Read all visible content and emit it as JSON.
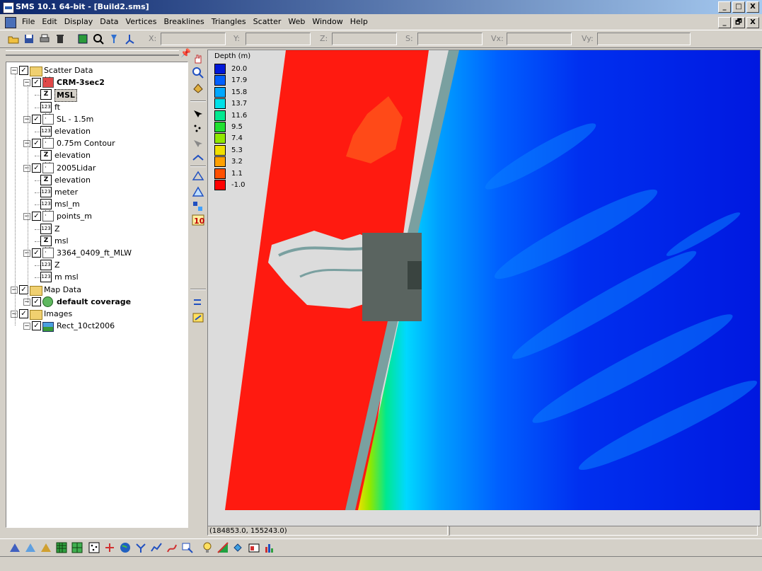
{
  "window": {
    "title": "SMS 10.1 64-bit - [Build2.sms]",
    "buttons": [
      "_",
      "□",
      "X"
    ],
    "mdi_buttons": [
      "_",
      "🗗",
      "X"
    ]
  },
  "menu": [
    "File",
    "Edit",
    "Display",
    "Data",
    "Vertices",
    "Breaklines",
    "Triangles",
    "Scatter",
    "Web",
    "Window",
    "Help"
  ],
  "toolbar": {
    "coord_labels": [
      "X:",
      "Y:",
      "Z:",
      "S:",
      "Vx:",
      "Vy:"
    ],
    "icons": [
      "open-icon",
      "save-icon",
      "print-icon",
      "delete-icon",
      "refresh-icon",
      "zoom-icon",
      "probe-icon",
      "axis-icon"
    ]
  },
  "tree": [
    {
      "label": "Scatter Data",
      "icon": "folder",
      "checked": true,
      "level": 0
    },
    {
      "label": "CRM-3sec2",
      "icon": "scatter-red",
      "checked": true,
      "level": 1,
      "bold": true
    },
    {
      "label": "MSL",
      "icon": "z",
      "level": 2,
      "selected": true
    },
    {
      "label": "ft",
      "icon": "123",
      "level": 2
    },
    {
      "label": "SL - 1.5m",
      "icon": "scatter",
      "checked": true,
      "level": 1
    },
    {
      "label": "elevation",
      "icon": "123",
      "level": 2
    },
    {
      "label": "0.75m Contour",
      "icon": "scatter",
      "checked": true,
      "level": 1
    },
    {
      "label": "elevation",
      "icon": "z",
      "level": 2
    },
    {
      "label": "2005Lidar",
      "icon": "scatter",
      "checked": true,
      "level": 1
    },
    {
      "label": "elevation",
      "icon": "z",
      "level": 2
    },
    {
      "label": "meter",
      "icon": "123",
      "level": 2
    },
    {
      "label": "msl_m",
      "icon": "123",
      "level": 2
    },
    {
      "label": "points_m",
      "icon": "scatter",
      "checked": true,
      "level": 1
    },
    {
      "label": "Z",
      "icon": "123",
      "level": 2
    },
    {
      "label": "msl",
      "icon": "z",
      "level": 2
    },
    {
      "label": "3364_0409_ft_MLW",
      "icon": "scatter",
      "checked": true,
      "level": 1
    },
    {
      "label": "Z",
      "icon": "123",
      "level": 2
    },
    {
      "label": "m msl",
      "icon": "123",
      "level": 2
    },
    {
      "label": "Map Data",
      "icon": "folder-map",
      "checked": true,
      "level": 0
    },
    {
      "label": "default coverage",
      "icon": "globe",
      "checked": true,
      "level": 1,
      "bold": true
    },
    {
      "label": "Images",
      "icon": "folder-image",
      "checked": true,
      "level": 0
    },
    {
      "label": "Rect_10ct2006",
      "icon": "image",
      "checked": true,
      "level": 1
    }
  ],
  "legend": {
    "title": "Depth (m)",
    "entries": [
      {
        "value": "20.0",
        "color": "#0018d8"
      },
      {
        "value": "17.9",
        "color": "#0060ff"
      },
      {
        "value": "15.8",
        "color": "#00a8ff"
      },
      {
        "value": "13.7",
        "color": "#00e0e8"
      },
      {
        "value": "11.6",
        "color": "#00e890"
      },
      {
        "value": "9.5",
        "color": "#20e030"
      },
      {
        "value": "7.4",
        "color": "#90e800"
      },
      {
        "value": "5.3",
        "color": "#f0e000"
      },
      {
        "value": "3.2",
        "color": "#ffa000"
      },
      {
        "value": "1.1",
        "color": "#ff5000"
      },
      {
        "value": "-1.0",
        "color": "#ff0000"
      }
    ]
  },
  "status": {
    "coords": "(184853.0, 155243.0)"
  },
  "colors": {
    "land": "#ff1a10",
    "beach": "#7aa0a0",
    "deep": "#0a1ce8",
    "background": "#dcdcdc"
  }
}
